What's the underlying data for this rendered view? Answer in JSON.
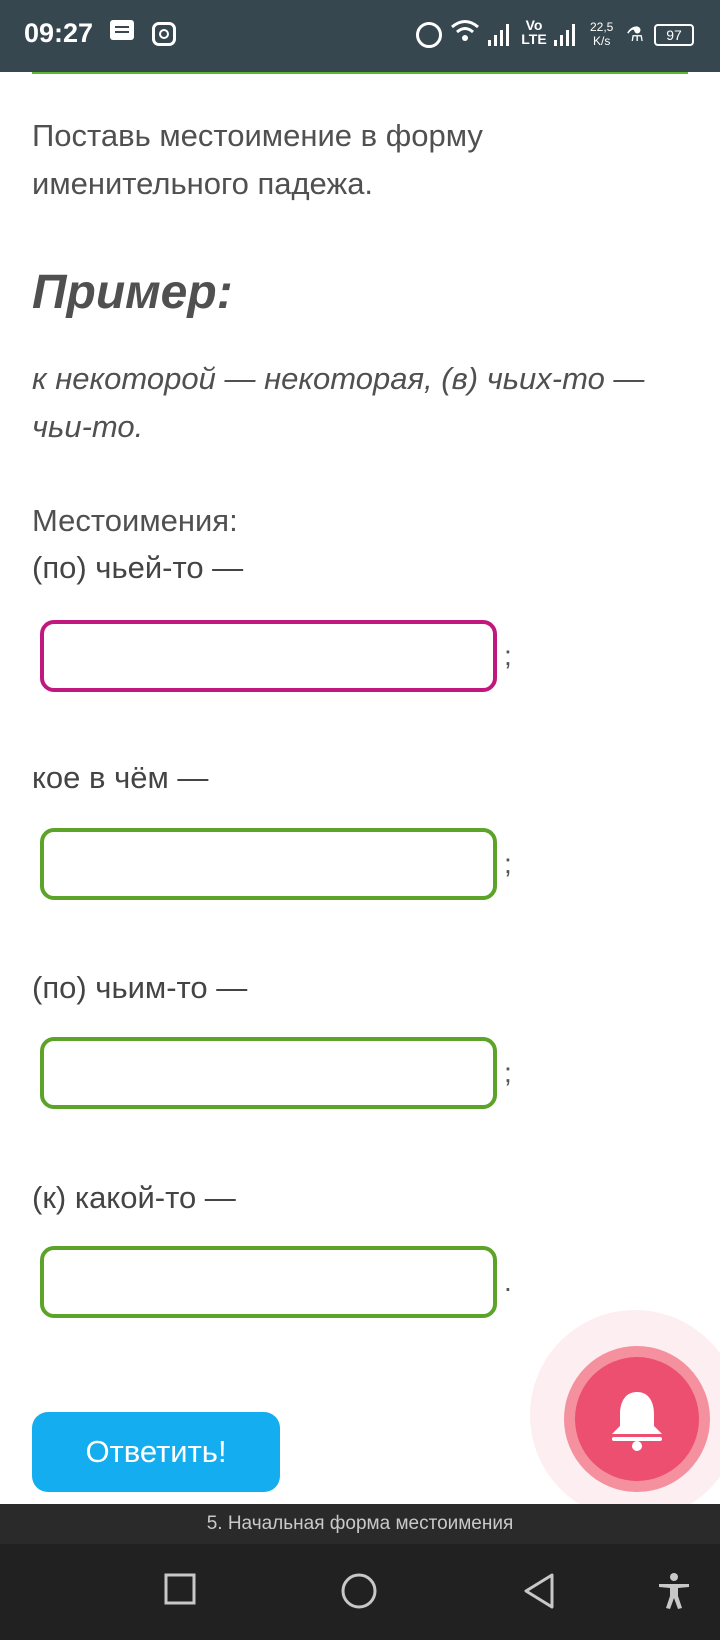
{
  "status_bar": {
    "time": "09:27",
    "network": "Vo LTE",
    "speed_value": "22,5",
    "speed_unit": "K/s",
    "battery": "97",
    "icons": [
      "notes-icon",
      "instagram-icon",
      "alarm-icon",
      "wifi-icon",
      "signal-icon",
      "signal-icon",
      "flask-icon",
      "battery-icon"
    ]
  },
  "task": {
    "instruction": "Поставь местоимение в форму именительного падежа.",
    "example_title": "Пример:",
    "example_text": "к некоторой — некоторая, (в) чьих-то — чьи-то.",
    "pronouns_label": "Местоимения:",
    "items": [
      {
        "label": "(по) чьей-то —",
        "value": "",
        "punct": ";",
        "state": "focused"
      },
      {
        "label": "кое в чём —",
        "value": "",
        "punct": ";",
        "state": "default"
      },
      {
        "label": "(по) чьим-то —",
        "value": "",
        "punct": ";",
        "state": "default"
      },
      {
        "label": "(к) какой-то —",
        "value": "",
        "punct": ".",
        "state": "default"
      }
    ],
    "submit_label": "Ответить!"
  },
  "lesson_bar": {
    "title": "5. Начальная форма местоимения"
  },
  "colors": {
    "accent_green": "#5ca329",
    "focus_magenta": "#c0187f",
    "button_blue": "#14aef0",
    "bell_pink": "#ec4f70"
  }
}
